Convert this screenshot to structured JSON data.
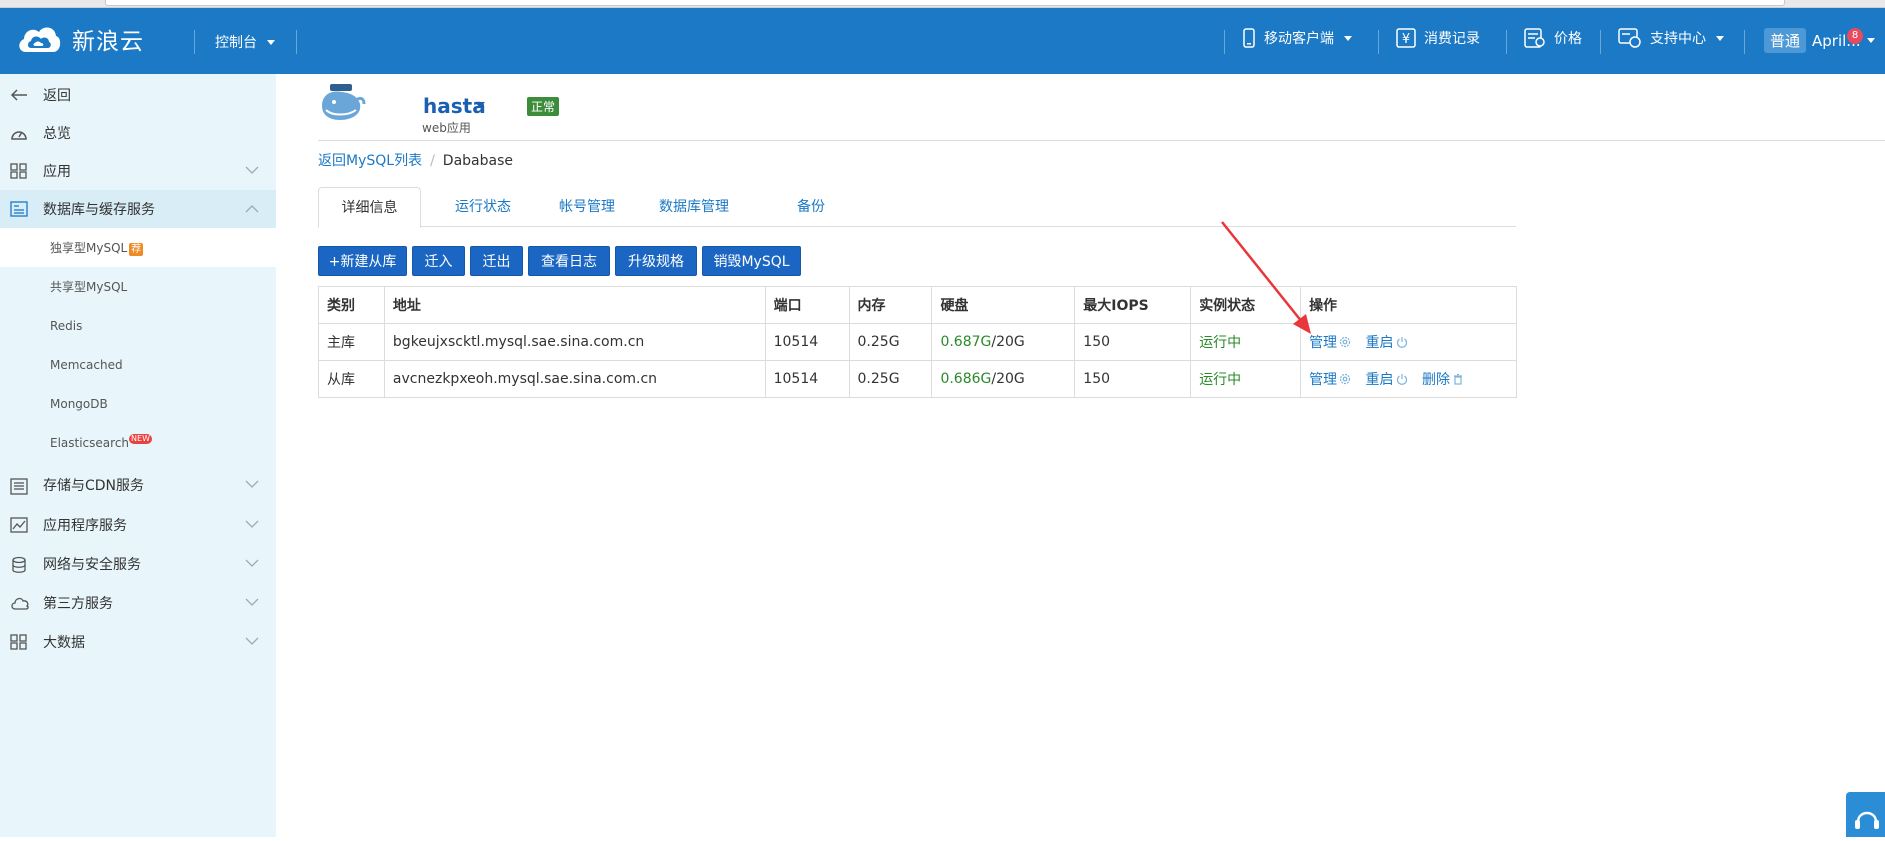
{
  "header": {
    "brand": "新浪云",
    "console_label": "控制台",
    "mobile_label": "移动客户端",
    "billing_label": "消费记录",
    "price_label": "价格",
    "support_label": "支持中心",
    "plan_badge": "普通",
    "user_name": "April...",
    "notification_count": "8"
  },
  "sidebar": {
    "back": "返回",
    "overview": "总览",
    "apps": "应用",
    "db_cache": "数据库与缓存服务",
    "sub": {
      "mysql_dedicated": "独享型MySQL",
      "mysql_dedicated_tag": "荐",
      "mysql_shared": "共享型MySQL",
      "redis": "Redis",
      "memcached": "Memcached",
      "mongodb": "MongoDB",
      "elasticsearch": "Elasticsearch",
      "elasticsearch_tag": "NEW"
    },
    "storage_cdn": "存储与CDN服务",
    "app_services": "应用程序服务",
    "net_security": "网络与安全服务",
    "third_party": "第三方服务",
    "bigdata": "大数据"
  },
  "app": {
    "name": "hasta",
    "type": "web应用",
    "status": "正常"
  },
  "breadcrumb": {
    "back_link": "返回MySQL列表",
    "current": "Dababase"
  },
  "tabs": [
    "详细信息",
    "运行状态",
    "帐号管理",
    "数据库管理",
    "备份"
  ],
  "buttons": {
    "new_slave": "+新建从库",
    "migrate_in": "迁入",
    "migrate_out": "迁出",
    "view_logs": "查看日志",
    "upgrade": "升级规格",
    "destroy": "销毁MySQL"
  },
  "table": {
    "headers": [
      "类别",
      "地址",
      "端口",
      "内存",
      "硬盘",
      "最大IOPS",
      "实例状态",
      "操作"
    ],
    "rows": [
      {
        "type": "主库",
        "address": "bgkeujxscktl.mysql.sae.sina.com.cn",
        "port": "10514",
        "memory": "0.25G",
        "disk_used": "0.687G",
        "disk_total": "/20G",
        "iops": "150",
        "status": "运行中",
        "manage": "管理",
        "restart": "重启"
      },
      {
        "type": "从库",
        "address": "avcnezkpxeoh.mysql.sae.sina.com.cn",
        "port": "10514",
        "memory": "0.25G",
        "disk_used": "0.686G",
        "disk_total": "/20G",
        "iops": "150",
        "status": "运行中",
        "manage": "管理",
        "restart": "重启",
        "delete": "删除"
      }
    ]
  },
  "colors": {
    "header_bg": "#1b79c5",
    "sidebar_bg": "#e8f6fb",
    "button_bg": "#1a66c2",
    "link": "#1b79c5",
    "running": "#2a8a2a",
    "annotation_arrow": "#e8363a"
  }
}
